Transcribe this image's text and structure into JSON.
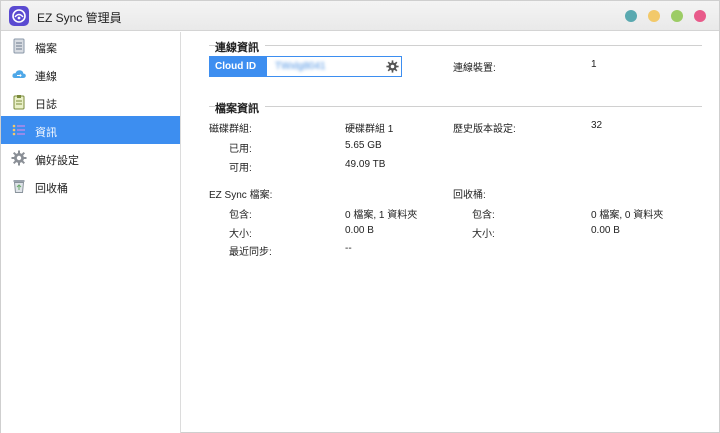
{
  "window": {
    "title": "EZ Sync 管理員"
  },
  "title_buttons": [
    {
      "name": "window-dot-teal",
      "color": "#5aa9b0"
    },
    {
      "name": "window-dot-yellow",
      "color": "#f2c96a"
    },
    {
      "name": "window-dot-green",
      "color": "#9ccc65"
    },
    {
      "name": "window-dot-pink",
      "color": "#e85a8a"
    }
  ],
  "sidebar": {
    "items": [
      {
        "label": "檔案",
        "icon": "file-icon",
        "active": false
      },
      {
        "label": "連線",
        "icon": "cloud-icon",
        "active": false
      },
      {
        "label": "日誌",
        "icon": "clipboard-icon",
        "active": false
      },
      {
        "label": "資訊",
        "icon": "info-list-icon",
        "active": true
      },
      {
        "label": "偏好設定",
        "icon": "gear-icon",
        "active": false
      },
      {
        "label": "回收桶",
        "icon": "recycle-bin-icon",
        "active": false
      }
    ]
  },
  "connection": {
    "title": "連線資訊",
    "cloud_id_label": "Cloud ID",
    "cloud_id_value": "TWxlg8041",
    "device_label": "連線裝置:",
    "device_value": "1"
  },
  "files": {
    "title": "檔案資訊",
    "volume_label": "磁碟群組:",
    "volume_value": "硬碟群組 1",
    "history_label": "歷史版本設定:",
    "history_value": "32",
    "used_label": "已用:",
    "used_value": "5.65 GB",
    "free_label": "可用:",
    "free_value": "49.09 TB",
    "ezsync_label": "EZ Sync 檔案:",
    "ez_contains_label": "包含:",
    "ez_contains_value": "0 檔案, 1 資料夾",
    "ez_size_label": "大小:",
    "ez_size_value": "0.00 B",
    "ez_last_sync_label": "最近同步:",
    "ez_last_sync_value": "--",
    "bin_label": "回收桶:",
    "bin_contains_label": "包含:",
    "bin_contains_value": "0 檔案, 0 資料夾",
    "bin_size_label": "大小:",
    "bin_size_value": "0.00 B"
  },
  "colors": {
    "accent": "#3d8ef0",
    "app_icon": "#5a4ad1"
  }
}
